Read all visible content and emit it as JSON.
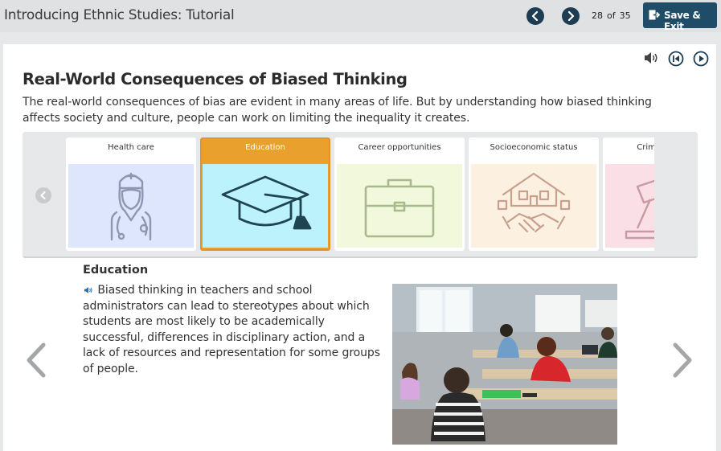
{
  "topbar": {
    "title": "Introducing Ethnic Studies: Tutorial",
    "prev_icon": "chevron-left-icon",
    "next_icon": "chevron-right-icon",
    "page_current": "28",
    "page_of": "of",
    "page_total": "35",
    "save_label": "Save & Exit",
    "save_icon": "exit-icon"
  },
  "controls": {
    "audio_icon": "speaker-icon",
    "restart_icon": "skip-back-icon",
    "play_icon": "play-icon"
  },
  "main": {
    "title": "Real-World Consequences of Biased Thinking",
    "intro": "The real-world consequences of bias are evident in many areas of life. But by understanding how biased thinking affects society and culture, people can work on limiting the inequality it creates."
  },
  "carousel": {
    "cards": [
      {
        "label": "Health care",
        "icon": "nurse-icon",
        "bg": "#dde6fc",
        "stroke": "#8e97b2"
      },
      {
        "label": "Education",
        "icon": "graduation-cap-icon",
        "bg": "#bcf2fb",
        "stroke": "#1f4452",
        "active": true
      },
      {
        "label": "Career opportunities",
        "icon": "briefcase-icon",
        "bg": "#f2f8dc",
        "stroke": "#a8b98c"
      },
      {
        "label": "Socioeconomic status",
        "icon": "house-handshake-icon",
        "bg": "#fcf1e1",
        "stroke": "#c8a08e"
      },
      {
        "label": "Criminal justice",
        "icon": "gavel-icon",
        "bg": "#fae0e6",
        "stroke": "#c99aa4"
      }
    ],
    "accent": "#eaa02c"
  },
  "detail": {
    "title": "Education",
    "body": "Biased thinking in teachers and school administrators can lead to stereotypes about which students are most likely to be academically successful, differences in disciplinary action, and a lack of resources and representation for some groups of people."
  }
}
